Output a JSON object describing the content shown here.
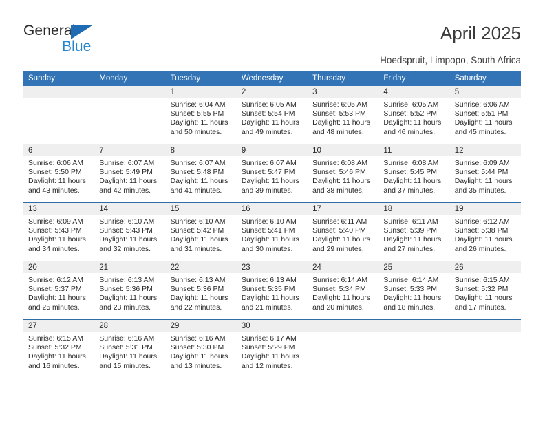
{
  "brand": {
    "name_part1": "General",
    "name_part2": "Blue",
    "accent_color": "#2185d0",
    "triangle_color": "#1f6cb4"
  },
  "header": {
    "title": "April 2025",
    "subtitle": "Hoedspruit, Limpopo, South Africa"
  },
  "calendar": {
    "header_bg": "#3274b6",
    "daynum_band_bg": "#efefef",
    "row_divider_color": "#2f6ca8",
    "weekday_headers": [
      "Sunday",
      "Monday",
      "Tuesday",
      "Wednesday",
      "Thursday",
      "Friday",
      "Saturday"
    ],
    "weeks": [
      [
        {
          "day": "",
          "sunrise": "",
          "sunset": "",
          "daylight_line1": "",
          "daylight_line2": ""
        },
        {
          "day": "",
          "sunrise": "",
          "sunset": "",
          "daylight_line1": "",
          "daylight_line2": ""
        },
        {
          "day": "1",
          "sunrise": "Sunrise: 6:04 AM",
          "sunset": "Sunset: 5:55 PM",
          "daylight_line1": "Daylight: 11 hours",
          "daylight_line2": "and 50 minutes."
        },
        {
          "day": "2",
          "sunrise": "Sunrise: 6:05 AM",
          "sunset": "Sunset: 5:54 PM",
          "daylight_line1": "Daylight: 11 hours",
          "daylight_line2": "and 49 minutes."
        },
        {
          "day": "3",
          "sunrise": "Sunrise: 6:05 AM",
          "sunset": "Sunset: 5:53 PM",
          "daylight_line1": "Daylight: 11 hours",
          "daylight_line2": "and 48 minutes."
        },
        {
          "day": "4",
          "sunrise": "Sunrise: 6:05 AM",
          "sunset": "Sunset: 5:52 PM",
          "daylight_line1": "Daylight: 11 hours",
          "daylight_line2": "and 46 minutes."
        },
        {
          "day": "5",
          "sunrise": "Sunrise: 6:06 AM",
          "sunset": "Sunset: 5:51 PM",
          "daylight_line1": "Daylight: 11 hours",
          "daylight_line2": "and 45 minutes."
        }
      ],
      [
        {
          "day": "6",
          "sunrise": "Sunrise: 6:06 AM",
          "sunset": "Sunset: 5:50 PM",
          "daylight_line1": "Daylight: 11 hours",
          "daylight_line2": "and 43 minutes."
        },
        {
          "day": "7",
          "sunrise": "Sunrise: 6:07 AM",
          "sunset": "Sunset: 5:49 PM",
          "daylight_line1": "Daylight: 11 hours",
          "daylight_line2": "and 42 minutes."
        },
        {
          "day": "8",
          "sunrise": "Sunrise: 6:07 AM",
          "sunset": "Sunset: 5:48 PM",
          "daylight_line1": "Daylight: 11 hours",
          "daylight_line2": "and 41 minutes."
        },
        {
          "day": "9",
          "sunrise": "Sunrise: 6:07 AM",
          "sunset": "Sunset: 5:47 PM",
          "daylight_line1": "Daylight: 11 hours",
          "daylight_line2": "and 39 minutes."
        },
        {
          "day": "10",
          "sunrise": "Sunrise: 6:08 AM",
          "sunset": "Sunset: 5:46 PM",
          "daylight_line1": "Daylight: 11 hours",
          "daylight_line2": "and 38 minutes."
        },
        {
          "day": "11",
          "sunrise": "Sunrise: 6:08 AM",
          "sunset": "Sunset: 5:45 PM",
          "daylight_line1": "Daylight: 11 hours",
          "daylight_line2": "and 37 minutes."
        },
        {
          "day": "12",
          "sunrise": "Sunrise: 6:09 AM",
          "sunset": "Sunset: 5:44 PM",
          "daylight_line1": "Daylight: 11 hours",
          "daylight_line2": "and 35 minutes."
        }
      ],
      [
        {
          "day": "13",
          "sunrise": "Sunrise: 6:09 AM",
          "sunset": "Sunset: 5:43 PM",
          "daylight_line1": "Daylight: 11 hours",
          "daylight_line2": "and 34 minutes."
        },
        {
          "day": "14",
          "sunrise": "Sunrise: 6:10 AM",
          "sunset": "Sunset: 5:43 PM",
          "daylight_line1": "Daylight: 11 hours",
          "daylight_line2": "and 32 minutes."
        },
        {
          "day": "15",
          "sunrise": "Sunrise: 6:10 AM",
          "sunset": "Sunset: 5:42 PM",
          "daylight_line1": "Daylight: 11 hours",
          "daylight_line2": "and 31 minutes."
        },
        {
          "day": "16",
          "sunrise": "Sunrise: 6:10 AM",
          "sunset": "Sunset: 5:41 PM",
          "daylight_line1": "Daylight: 11 hours",
          "daylight_line2": "and 30 minutes."
        },
        {
          "day": "17",
          "sunrise": "Sunrise: 6:11 AM",
          "sunset": "Sunset: 5:40 PM",
          "daylight_line1": "Daylight: 11 hours",
          "daylight_line2": "and 29 minutes."
        },
        {
          "day": "18",
          "sunrise": "Sunrise: 6:11 AM",
          "sunset": "Sunset: 5:39 PM",
          "daylight_line1": "Daylight: 11 hours",
          "daylight_line2": "and 27 minutes."
        },
        {
          "day": "19",
          "sunrise": "Sunrise: 6:12 AM",
          "sunset": "Sunset: 5:38 PM",
          "daylight_line1": "Daylight: 11 hours",
          "daylight_line2": "and 26 minutes."
        }
      ],
      [
        {
          "day": "20",
          "sunrise": "Sunrise: 6:12 AM",
          "sunset": "Sunset: 5:37 PM",
          "daylight_line1": "Daylight: 11 hours",
          "daylight_line2": "and 25 minutes."
        },
        {
          "day": "21",
          "sunrise": "Sunrise: 6:13 AM",
          "sunset": "Sunset: 5:36 PM",
          "daylight_line1": "Daylight: 11 hours",
          "daylight_line2": "and 23 minutes."
        },
        {
          "day": "22",
          "sunrise": "Sunrise: 6:13 AM",
          "sunset": "Sunset: 5:36 PM",
          "daylight_line1": "Daylight: 11 hours",
          "daylight_line2": "and 22 minutes."
        },
        {
          "day": "23",
          "sunrise": "Sunrise: 6:13 AM",
          "sunset": "Sunset: 5:35 PM",
          "daylight_line1": "Daylight: 11 hours",
          "daylight_line2": "and 21 minutes."
        },
        {
          "day": "24",
          "sunrise": "Sunrise: 6:14 AM",
          "sunset": "Sunset: 5:34 PM",
          "daylight_line1": "Daylight: 11 hours",
          "daylight_line2": "and 20 minutes."
        },
        {
          "day": "25",
          "sunrise": "Sunrise: 6:14 AM",
          "sunset": "Sunset: 5:33 PM",
          "daylight_line1": "Daylight: 11 hours",
          "daylight_line2": "and 18 minutes."
        },
        {
          "day": "26",
          "sunrise": "Sunrise: 6:15 AM",
          "sunset": "Sunset: 5:32 PM",
          "daylight_line1": "Daylight: 11 hours",
          "daylight_line2": "and 17 minutes."
        }
      ],
      [
        {
          "day": "27",
          "sunrise": "Sunrise: 6:15 AM",
          "sunset": "Sunset: 5:32 PM",
          "daylight_line1": "Daylight: 11 hours",
          "daylight_line2": "and 16 minutes."
        },
        {
          "day": "28",
          "sunrise": "Sunrise: 6:16 AM",
          "sunset": "Sunset: 5:31 PM",
          "daylight_line1": "Daylight: 11 hours",
          "daylight_line2": "and 15 minutes."
        },
        {
          "day": "29",
          "sunrise": "Sunrise: 6:16 AM",
          "sunset": "Sunset: 5:30 PM",
          "daylight_line1": "Daylight: 11 hours",
          "daylight_line2": "and 13 minutes."
        },
        {
          "day": "30",
          "sunrise": "Sunrise: 6:17 AM",
          "sunset": "Sunset: 5:29 PM",
          "daylight_line1": "Daylight: 11 hours",
          "daylight_line2": "and 12 minutes."
        },
        {
          "day": "",
          "sunrise": "",
          "sunset": "",
          "daylight_line1": "",
          "daylight_line2": ""
        },
        {
          "day": "",
          "sunrise": "",
          "sunset": "",
          "daylight_line1": "",
          "daylight_line2": ""
        },
        {
          "day": "",
          "sunrise": "",
          "sunset": "",
          "daylight_line1": "",
          "daylight_line2": ""
        }
      ]
    ]
  }
}
